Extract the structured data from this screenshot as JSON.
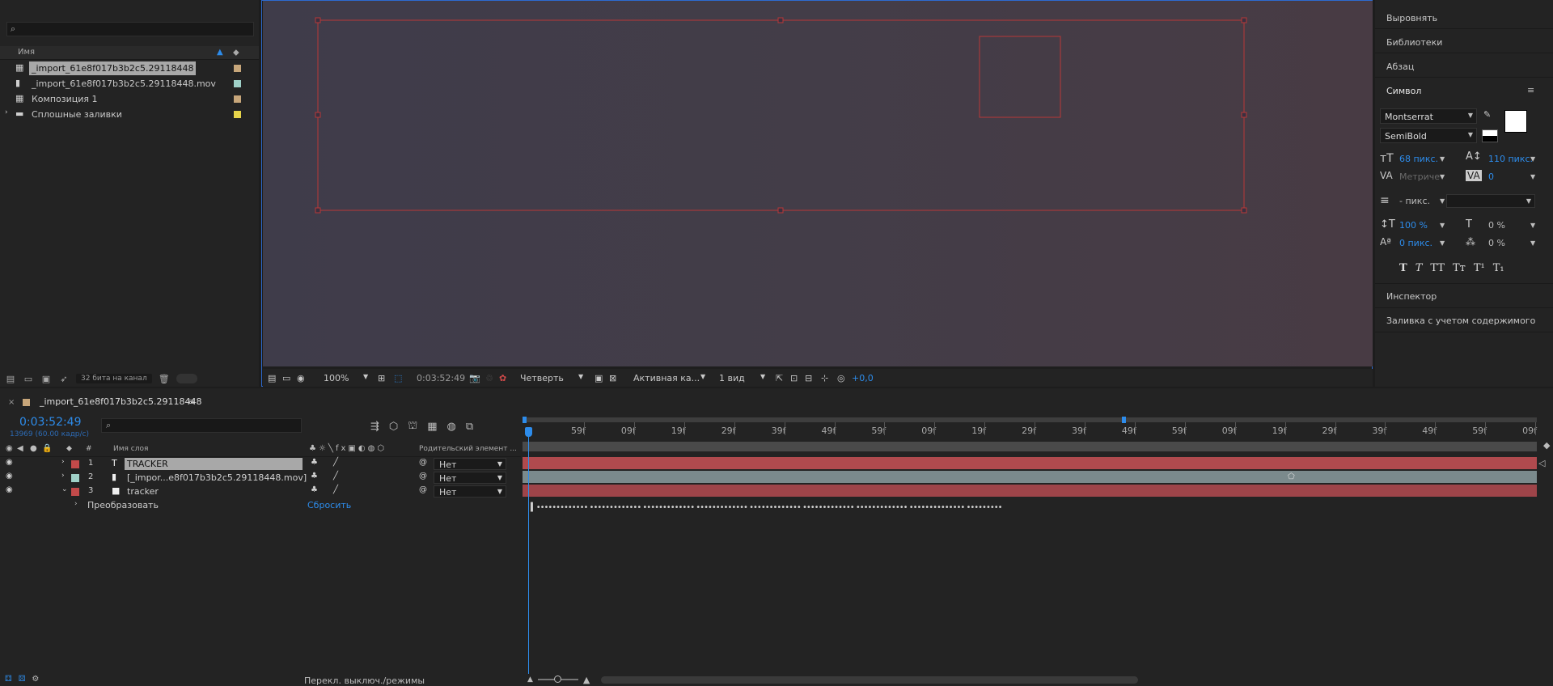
{
  "project": {
    "search_placeholder": "",
    "col_name": "Имя",
    "items": [
      {
        "name": "_import_61e8f017b3b2c5.29118448",
        "color": "#c7a67a",
        "selected": true,
        "icon": "composition-icon"
      },
      {
        "name": "_import_61e8f017b3b2c5.29118448.mov",
        "color": "#9fd1c8",
        "selected": false,
        "icon": "footage-icon"
      },
      {
        "name": "Композиция 1",
        "color": "#c7a67a",
        "selected": false,
        "icon": "composition-icon"
      },
      {
        "name": "Сплошные заливки",
        "color": "#e6d44a",
        "selected": false,
        "icon": "folder-icon"
      }
    ],
    "bit_depth": "32 бита на канал"
  },
  "viewer": {
    "zoom": "100%",
    "timecode": "0:03:52:49",
    "resolution": "Четверть",
    "camera": "Активная ка...",
    "views": "1 вид",
    "exposure": "+0,0"
  },
  "right_panel": {
    "align": "Выровнять",
    "libraries": "Библиотеки",
    "paragraph": "Абзац",
    "character": "Символ",
    "font": "Montserrat",
    "style": "SemiBold",
    "font_size": "68 пикс.",
    "leading": "110 пикс.",
    "kerning": "Метриче",
    "tracking": "0",
    "stroke": "- пикс.",
    "vscale": "100 %",
    "hscale": "0 %",
    "baseline": "0 пикс.",
    "tsume": "0 %",
    "style_buttons": [
      "T",
      "T",
      "TT",
      "Tт",
      "T¹",
      "T₁"
    ],
    "inspector": "Инспектор",
    "content_fill": "Заливка с учетом содержимого"
  },
  "timeline": {
    "comp_tab": "_import_61e8f017b3b2c5.29118448",
    "timecode": "0:03:52:49",
    "frame_info": "13969 (60.00 кадр/с)",
    "col_layer_name": "Имя слоя",
    "col_parent": "Родительский элемент ...",
    "layers": [
      {
        "num": "1",
        "name": "TRACKER",
        "type": "T",
        "color": "#c24a4a",
        "parent": "Нет",
        "selected": true
      },
      {
        "num": "2",
        "name": "[_impor...e8f017b3b2c5.29118448.mov]",
        "type": "footage",
        "color": "#9fd1c8",
        "parent": "Нет",
        "selected": false
      },
      {
        "num": "3",
        "name": "tracker",
        "type": "solid",
        "color": "#c24a4a",
        "parent": "Нет",
        "selected": false
      }
    ],
    "transform_label": "Преобразовать",
    "reset_label": "Сбросить",
    "ruler_labels": [
      "59f",
      "09f",
      "19f",
      "29f",
      "39f",
      "49f",
      "59f",
      "09f",
      "19f",
      "29f",
      "39f",
      "49f",
      "59f",
      "09f",
      "19f",
      "29f",
      "39f",
      "49f",
      "59f",
      "09f"
    ],
    "footer_toggle": "Перекл. выключ./режимы"
  }
}
